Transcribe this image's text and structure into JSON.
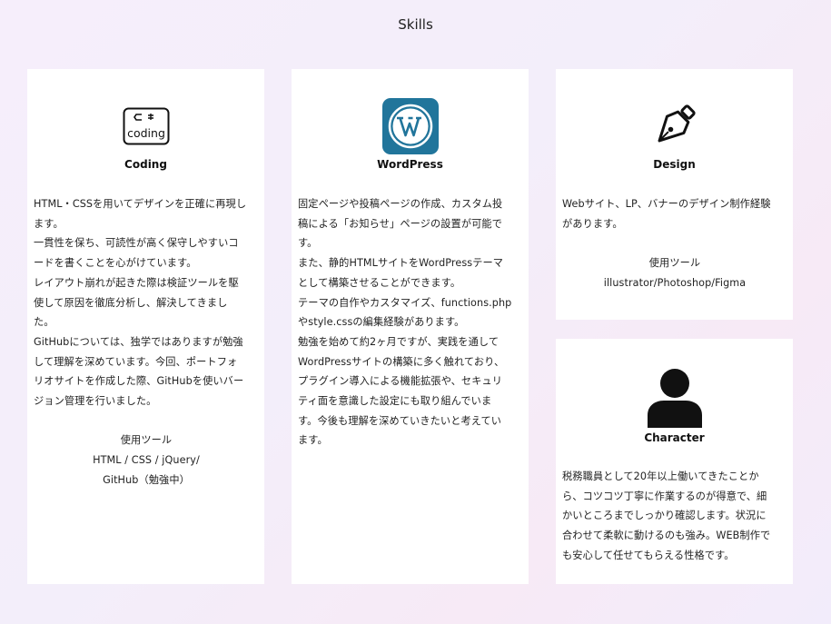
{
  "section": {
    "title": "Skills"
  },
  "cards": {
    "coding": {
      "icon": "coding-icon",
      "icon_text": "coding",
      "title": "Coding",
      "lines": [
        "HTML・CSSを用いてデザインを正確に再現し",
        "ます。",
        "一貫性を保ち、可読性が高く保守しやすいコ",
        "ードを書くことを心がけています。",
        "レイアウト崩れが起きた際は検証ツールを駆",
        "使して原因を徹底分析し、解決してきまし",
        "た。",
        "GitHubについては、独学ではありますが勉強",
        "して理解を深めています。今回、ポートフォ",
        "リオサイトを作成した際、GitHubを使いバー",
        "ジョン管理を行いました。"
      ],
      "tools_heading": "使用ツール",
      "tools_line1": "HTML / CSS /  jQuery/",
      "tools_line2": "GitHub（勉強中）"
    },
    "wordpress": {
      "icon": "wordpress-icon",
      "title": "WordPress",
      "lines": [
        "固定ページや投稿ページの作成、カスタム投",
        "稿による「お知らせ」ページの設置が可能で",
        "す。",
        "また、静的HTMLサイトをWordPressテーマ",
        "として構築させることができます。",
        "テーマの自作やカスタマイズ、functions.php",
        "やstyle.cssの編集経験があります。",
        "勉強を始めて約2ヶ月ですが、実践を通して",
        "WordPressサイトの構築に多く触れており、",
        "プラグイン導入による機能拡張や、セキュリ",
        "ティ面を意識した設定にも取り組んでいま",
        "す。今後も理解を深めていきたいと考えてい",
        "ます。"
      ]
    },
    "design": {
      "icon": "pen-nib-icon",
      "title": "Design",
      "lines": [
        "Webサイト、LP、バナーのデザイン制作経験",
        "があります。"
      ],
      "tools_heading": "使用ツール",
      "tools_line1": "illustrator/Photoshop/Figma"
    },
    "character": {
      "icon": "person-icon",
      "title": "Character",
      "lines": [
        "税務職員として20年以上働いてきたことか",
        "ら、コツコツ丁寧に作業するのが得意で、細",
        "かいところまでしっかり確認します。状況に",
        "合わせて柔軟に動けるのも強み。WEB制作で",
        "も安心して任せてもらえる性格です。"
      ]
    }
  },
  "colors": {
    "wordpress_blue": "#21759b",
    "card_bg": "#ffffff"
  }
}
